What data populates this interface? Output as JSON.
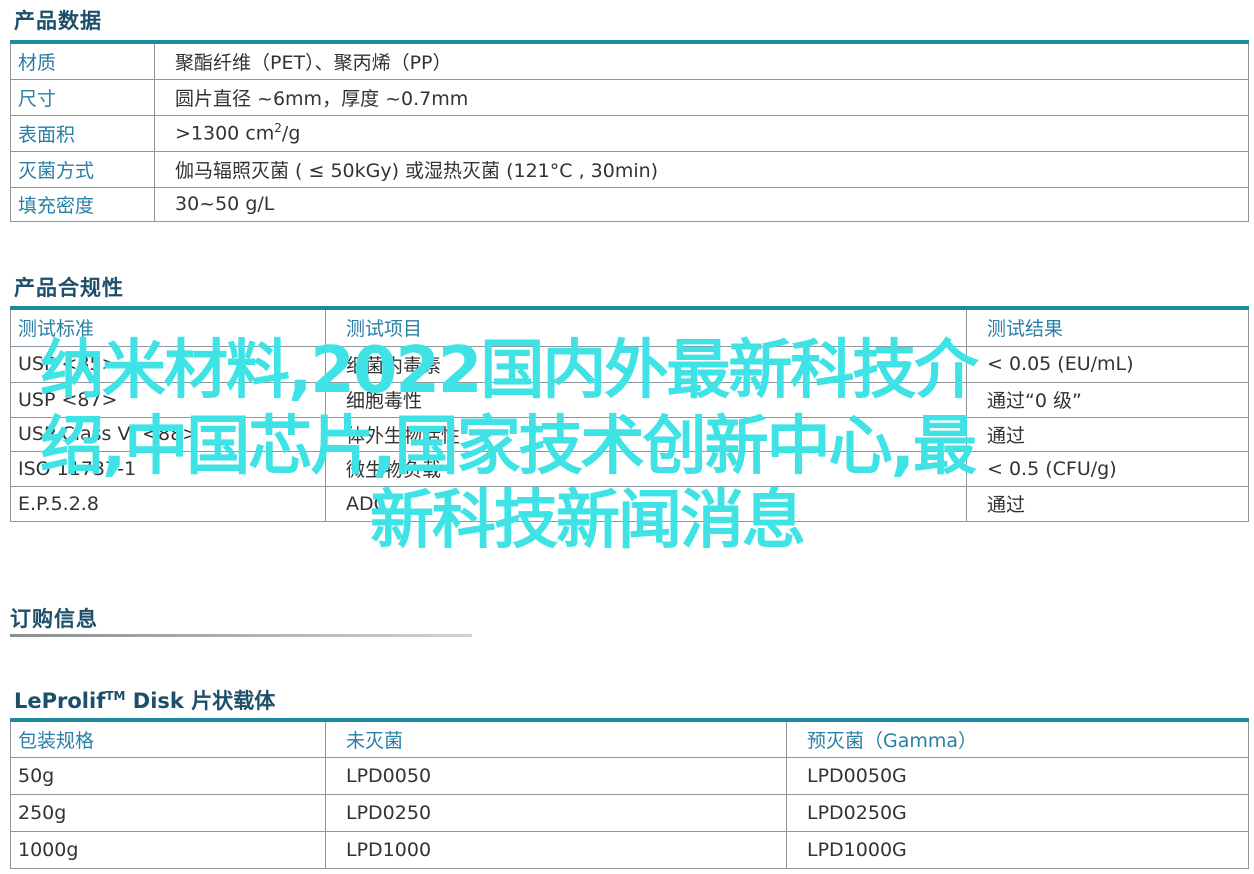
{
  "product_data": {
    "title": "产品数据",
    "rows": [
      {
        "key": "材质",
        "value": "聚酯纤维（PET）、聚丙烯（PP）"
      },
      {
        "key": "尺寸",
        "value": "圆片直径 ~6mm，厚度 ~0.7mm"
      },
      {
        "key": "表面积",
        "value_prefix": ">1300 cm",
        "value_sup": "2",
        "value_suffix": "/g"
      },
      {
        "key": "灭菌方式",
        "value": "伽马辐照灭菌 ( ≤ 50kGy) 或湿热灭菌 (121°C , 30min)"
      },
      {
        "key": "填充密度",
        "value": "30~50 g/L"
      }
    ]
  },
  "compliance": {
    "title": "产品合规性",
    "headers": [
      "测试标准",
      "测试项目",
      "测试结果"
    ],
    "rows": [
      [
        "USP <85>",
        "细菌内毒素",
        "< 0.05 (EU/mL)"
      ],
      [
        "USP <87>",
        "细胞毒性",
        "通过“0 级”"
      ],
      [
        "USP Class VI <88>",
        "体外生物活性",
        "通过"
      ],
      [
        "ISO 11737-1",
        "微生物负载",
        "< 0.5 (CFU/g)"
      ],
      [
        "E.P.5.2.8",
        "ADC",
        "通过"
      ]
    ]
  },
  "ordering": {
    "title": "订购信息"
  },
  "disk": {
    "title_prefix": "LeProlif",
    "title_sup": "TM",
    "title_suffix": " Disk 片状载体",
    "headers": [
      "包装规格",
      "未灭菌",
      "预灭菌（Gamma）"
    ],
    "rows": [
      [
        "50g",
        "LPD0050",
        "LPD0050G"
      ],
      [
        "250g",
        "LPD0250",
        "LPD0250G"
      ],
      [
        "1000g",
        "LPD1000",
        "LPD1000G"
      ]
    ]
  },
  "overlay": {
    "line1": "纳米材料,2022国内外最新科技介",
    "line2": "绍,中国芯片,国家技术创新中心,最",
    "line3": "新科技新闻消息"
  },
  "colors": {
    "accent": "#1e8aa0",
    "heading": "#1d4f6b",
    "key_text": "#2a7fa6",
    "overlay_text": "#3fe3e6"
  }
}
